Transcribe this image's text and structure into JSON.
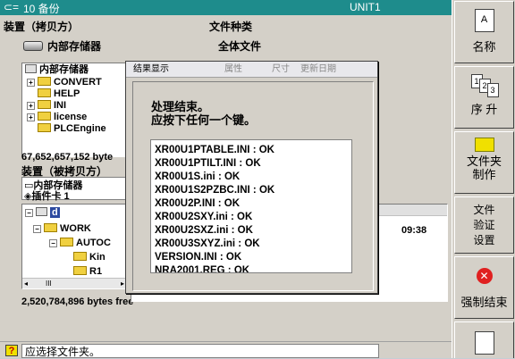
{
  "titlebar": {
    "title": "10 备份",
    "unit": "UNIT1"
  },
  "source": {
    "device_label": "装置（拷贝方）",
    "filetype_label": "文件种类",
    "device_value": "内部存储器",
    "filetype_value": "全体文件",
    "tree_root": "内部存储器",
    "tree_items": [
      "CONVERT",
      "HELP",
      "INI",
      "license",
      "PLCEngine"
    ],
    "free": "67,652,657,152 byte"
  },
  "dest": {
    "device_label": "装置（被拷贝方）",
    "device_value": "内部存储器",
    "card_value": "插件卡 1",
    "tree_root": "d",
    "tree_items": [
      "WORK",
      "AUTOC",
      "Kin",
      "R1"
    ],
    "time": "09:38",
    "scroll_label": "III",
    "free": "2,520,784,896 bytes free"
  },
  "dialog": {
    "title": "结果显示",
    "bg_headers": [
      "属性",
      "尺寸",
      "更新日期"
    ],
    "message_line1": "处理结束。",
    "message_line2": "应按下任何一个键。",
    "results": [
      "XR00U1PTABLE.INI : OK",
      "XR00U1PTILT.INI : OK",
      "XR00U1S.ini : OK",
      "XR00U1S2PZBC.INI : OK",
      "XR00U2P.INI : OK",
      "XR00U2SXY.ini : OK",
      "XR00U2SXZ.ini : OK",
      "XR00U3SXYZ.ini : OK",
      "VERSION.INI : OK",
      "NRA2001.REG : OK"
    ]
  },
  "status": {
    "help_mark": "?",
    "text": "应选择文件夹。"
  },
  "buttons": {
    "name": "名称",
    "asc": "序 升",
    "folder_make_1": "文件夹",
    "folder_make_2": "制作",
    "verify_1": "文件",
    "verify_2": "验证",
    "verify_3": "设置",
    "force_end": "强制结束"
  },
  "colors": {
    "titlebar": "#1e8c8c",
    "selection": "#2d4aa0",
    "cancel_red": "#e02020",
    "folder": "#f0d040"
  }
}
